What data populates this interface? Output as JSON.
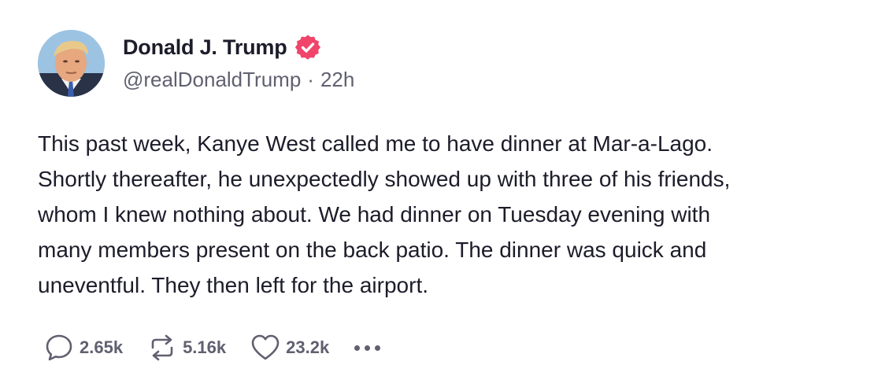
{
  "author": {
    "display_name": "Donald J. Trump",
    "handle": "@realDonaldTrump",
    "separator": "·",
    "time": "22h",
    "avatar_icon": "profile-photo",
    "verified_icon": "verified-badge-icon",
    "verified_color": "#f0446b"
  },
  "post": {
    "text": "This past week, Kanye West called me to have dinner at Mar-a-Lago.\nShortly thereafter, he unexpectedly showed up with three of his friends,\nwhom I knew nothing about. We had dinner on Tuesday evening with\nmany members present on the back patio. The dinner was quick and\nuneventful. They then left for the airport."
  },
  "actions": {
    "replies": {
      "icon": "reply-icon",
      "count": "2.65k"
    },
    "retruths": {
      "icon": "repost-icon",
      "count": "5.16k"
    },
    "likes": {
      "icon": "heart-icon",
      "count": "23.2k"
    },
    "more": {
      "icon": "more-icon"
    }
  },
  "colors": {
    "text": "#1c1c2a",
    "muted": "#606070",
    "background": "#ffffff"
  }
}
